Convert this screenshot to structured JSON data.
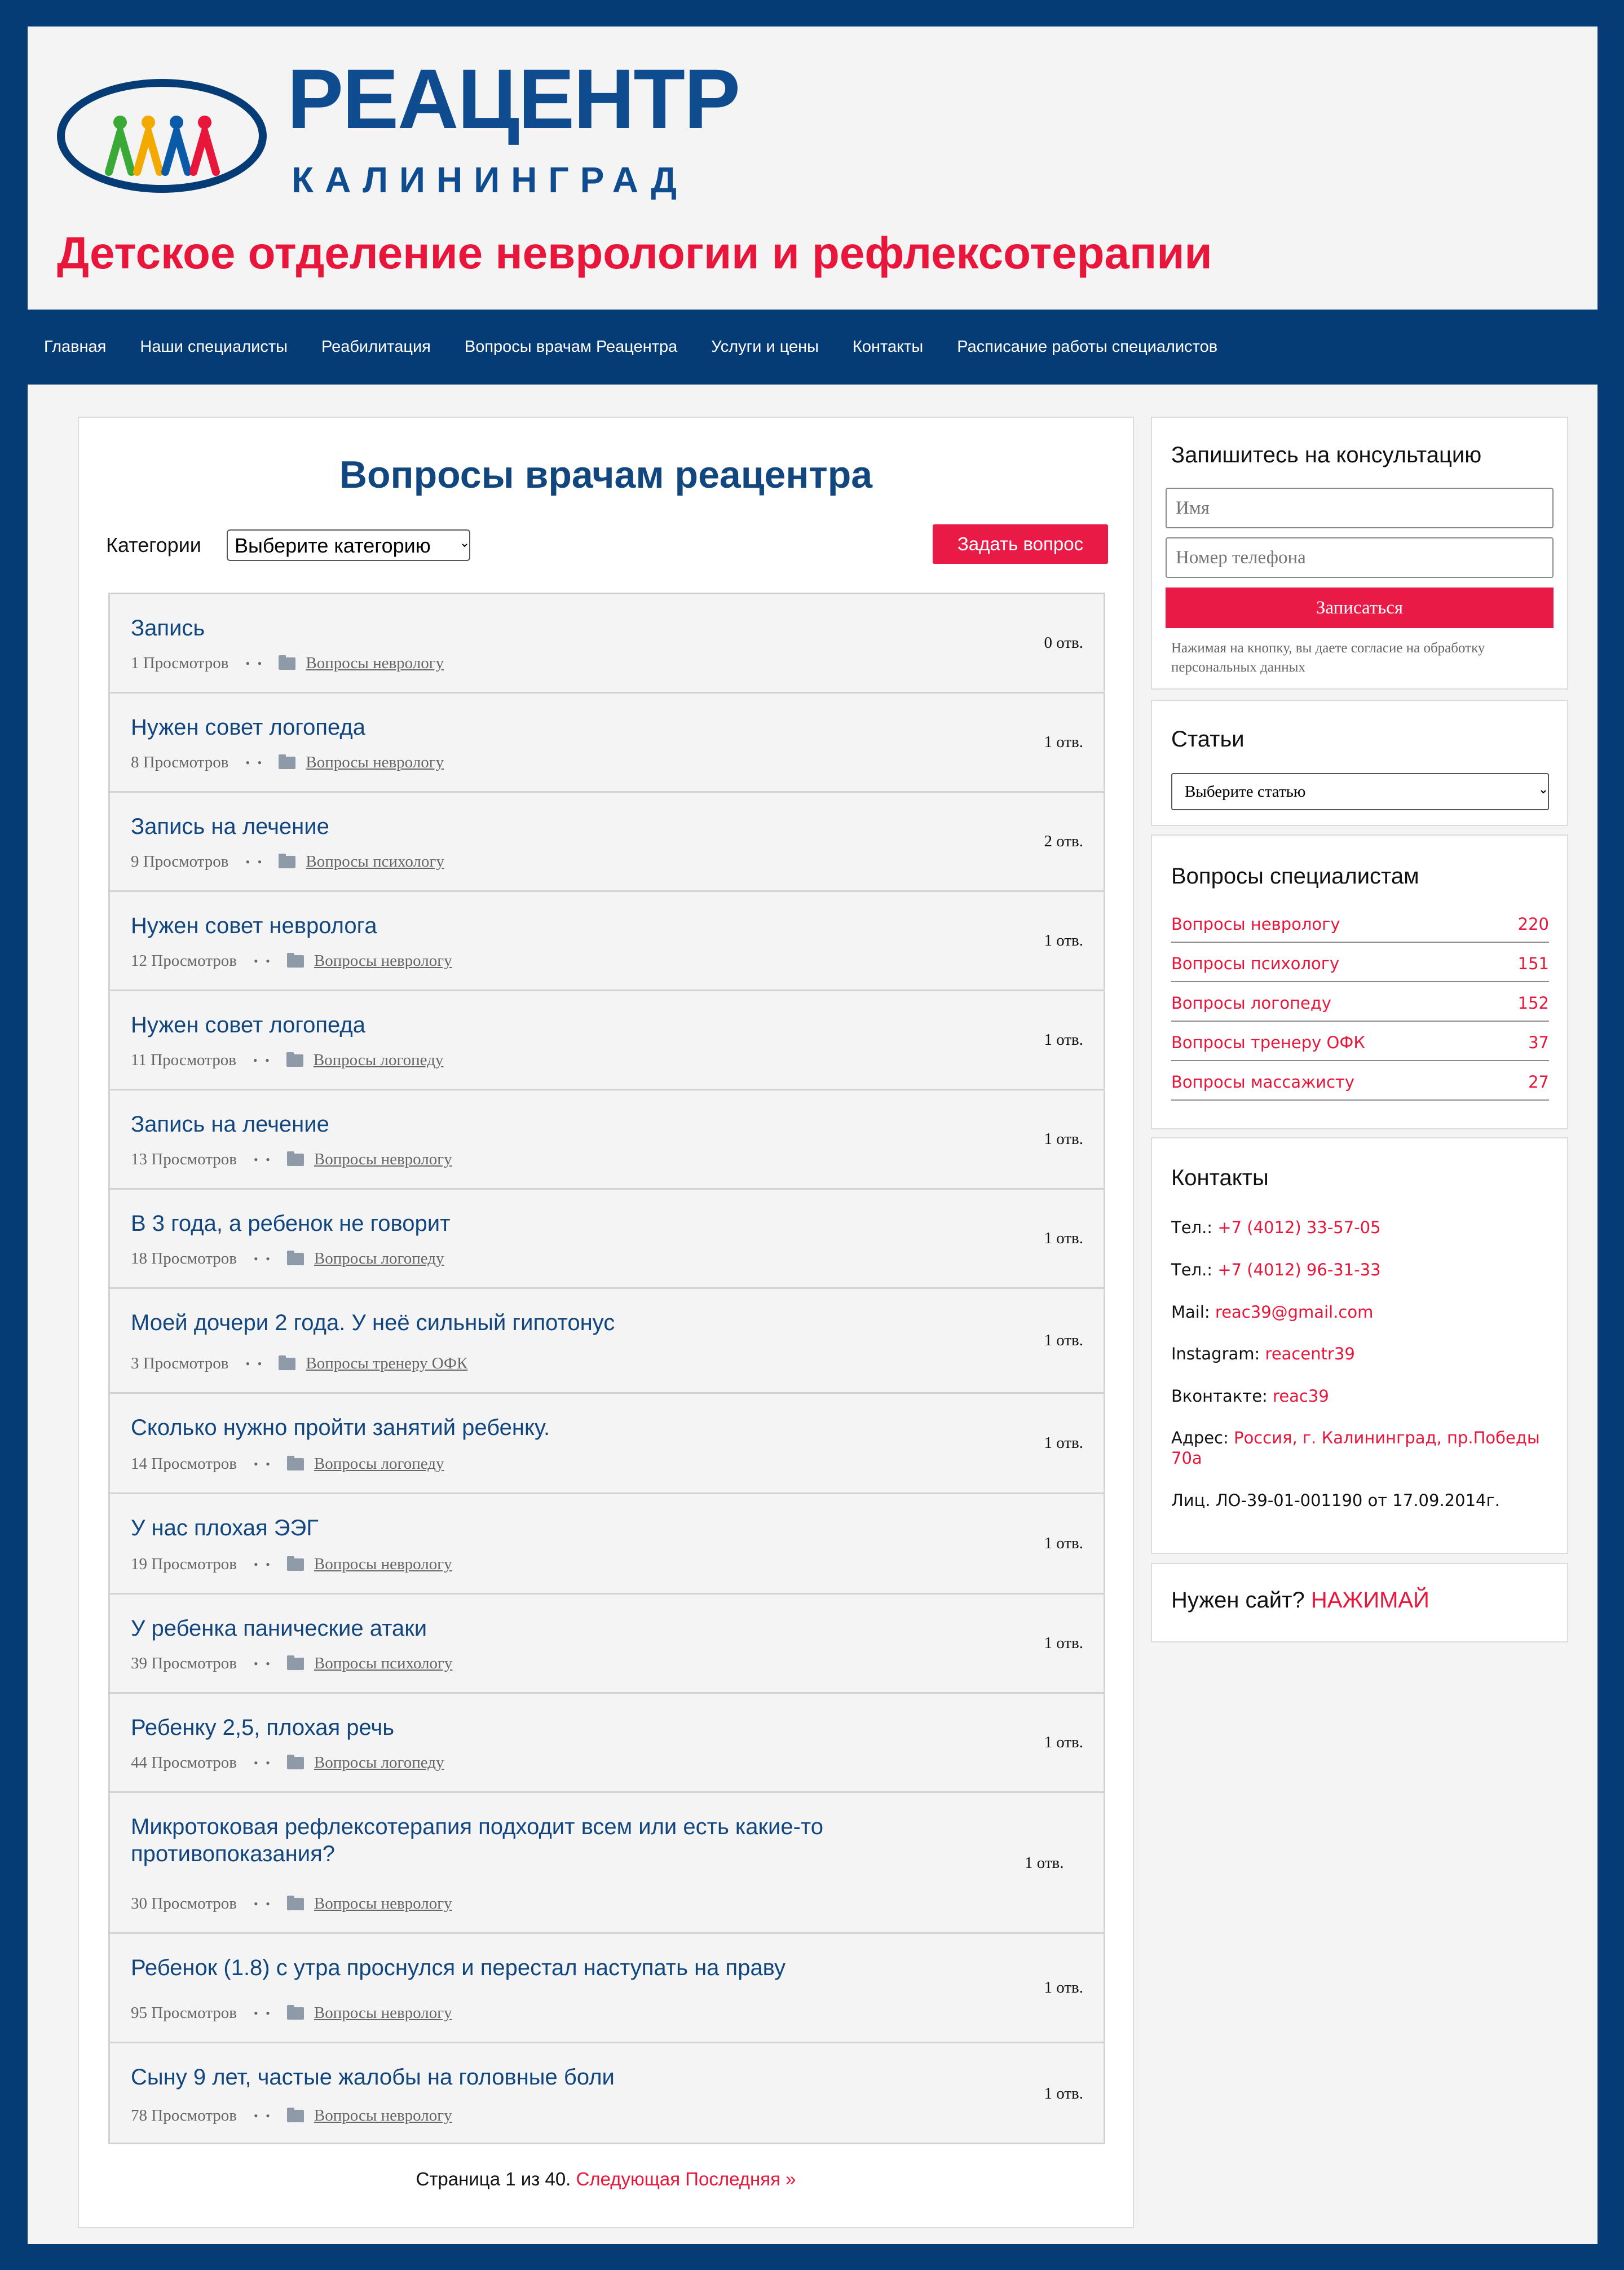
{
  "logo": {
    "main_text": "РЕАЦЕНТР",
    "sub_text": "КАЛИНИНГРАД",
    "people_colors": [
      "#3aa935",
      "#f2a900",
      "#0a5aa8",
      "#e8163b"
    ]
  },
  "site_title": "Детское отделение неврологии и рефлексотерапии",
  "nav": {
    "items": [
      "Главная",
      "Наши специалисты",
      "Реабилитация",
      "Вопросы врачам Реацентра",
      "Услуги и цены",
      "Контакты",
      "Расписание работы специалистов"
    ]
  },
  "main": {
    "title": "Вопросы врачам реацентра",
    "category_label": "Категории",
    "category_select": "Выберите категорию",
    "ask_button": "Задать вопрос",
    "questions": [
      {
        "title": "Запись",
        "views": "1 Просмотров",
        "category": "Вопросы неврологу",
        "answers": "0 отв."
      },
      {
        "title": "Нужен совет логопеда",
        "views": "8 Просмотров",
        "category": "Вопросы неврологу",
        "answers": "1 отв."
      },
      {
        "title": "Запись на лечение",
        "views": "9 Просмотров",
        "category": "Вопросы психологу",
        "answers": "2 отв."
      },
      {
        "title": "Нужен совет невролога",
        "views": "12 Просмотров",
        "category": "Вопросы неврологу",
        "answers": "1 отв."
      },
      {
        "title": "Нужен совет логопеда",
        "views": "11 Просмотров",
        "category": "Вопросы логопеду",
        "answers": "1 отв."
      },
      {
        "title": "Запись на лечение",
        "views": "13 Просмотров",
        "category": "Вопросы неврологу",
        "answers": "1 отв."
      },
      {
        "title": "В 3 года, а ребенок не говорит",
        "views": "18 Просмотров",
        "category": "Вопросы логопеду",
        "answers": "1 отв."
      },
      {
        "title": "Моей дочери 2 года. У неё сильный гипотонус",
        "views": "3 Просмотров",
        "category": "Вопросы тренеру ОФК",
        "answers": "1 отв."
      },
      {
        "title": "Сколько нужно пройти занятий ребенку.",
        "views": "14 Просмотров",
        "category": "Вопросы логопеду",
        "answers": "1 отв."
      },
      {
        "title": "У нас плохая ЭЭГ",
        "views": "19 Просмотров",
        "category": "Вопросы неврологу",
        "answers": "1 отв."
      },
      {
        "title": "У ребенка панические атаки",
        "views": "39 Просмотров",
        "category": "Вопросы психологу",
        "answers": "1 отв."
      },
      {
        "title": "Ребенку 2,5, плохая речь",
        "views": "44 Просмотров",
        "category": "Вопросы логопеду",
        "answers": "1 отв."
      },
      {
        "title": "Микротоковая рефлексотерапия подходит всем или есть какие-то противопоказания?",
        "views": "30 Просмотров",
        "category": "Вопросы неврологу",
        "answers": "1 отв."
      },
      {
        "title": "Ребенок (1.8) с утра проснулся и перестал наступать на праву",
        "views": "95 Просмотров",
        "category": "Вопросы неврологу",
        "answers": "1 отв."
      },
      {
        "title": "Сыну 9 лет, частые жалобы на головные боли",
        "views": "78 Просмотров",
        "category": "Вопросы неврологу",
        "answers": "1 отв."
      }
    ],
    "pagination": {
      "text": "Страница 1 из 40.",
      "next": "Следующая",
      "last": "Последняя »"
    }
  },
  "sidebar": {
    "consult": {
      "title": "Запишитесь на консультацию",
      "name_placeholder": "Имя",
      "phone_placeholder": "Номер телефона",
      "submit": "Записаться",
      "consent": "Нажимая на кнопку, вы даете согласие на обработку персональных данных"
    },
    "articles": {
      "title": "Статьи",
      "select": "Выберите статью"
    },
    "specialists": {
      "title": "Вопросы специалистам",
      "items": [
        {
          "label": "Вопросы неврологу",
          "count": "220"
        },
        {
          "label": "Вопросы психологу",
          "count": "151"
        },
        {
          "label": "Вопросы логопеду",
          "count": "152"
        },
        {
          "label": "Вопросы тренеру ОФК",
          "count": "37"
        },
        {
          "label": "Вопросы массажисту",
          "count": "27"
        }
      ]
    },
    "contacts": {
      "title": "Контакты",
      "phone1_label": "Тел.:",
      "phone1": "+7 (4012) 33-57-05",
      "phone2_label": "Тел.:",
      "phone2": "+7 (4012) 96-31-33",
      "mail_label": "Mail:",
      "mail": "reac39@gmail.com",
      "instagram_label": "Instagram:",
      "instagram": "reacentr39",
      "vk_label": "Вконтакте:",
      "vk": "reac39",
      "address_label": "Адрес:",
      "address": "Россия, г. Калининград, пр.Победы 70а",
      "license": "Лиц. ЛО-39-01-001190 от 17.09.2014г."
    },
    "site": {
      "question": "Нужен сайт?",
      "link": "НАЖИМАЙ"
    }
  },
  "colors": {
    "brand_blue": "#063c76",
    "accent_red": "#e8163b",
    "link_blue": "#12467f",
    "panel_bg": "#f4f4f4"
  }
}
